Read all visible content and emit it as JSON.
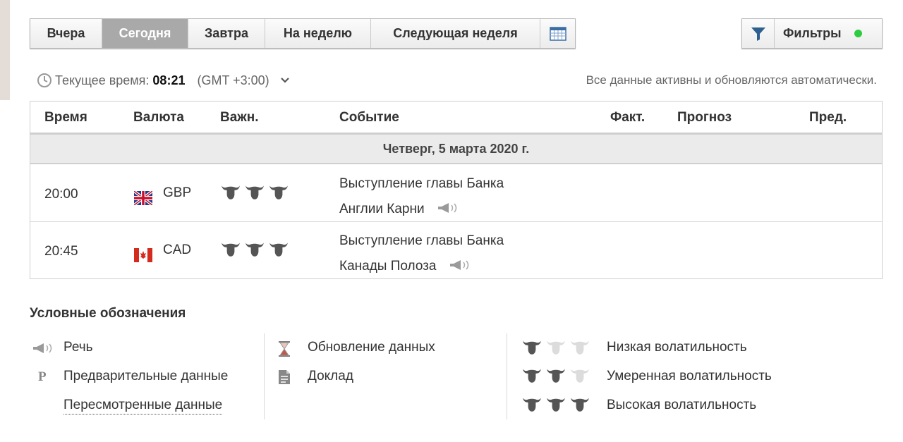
{
  "tabs": [
    {
      "label": "Вчера",
      "active": false
    },
    {
      "label": "Сегодня",
      "active": true
    },
    {
      "label": "Завтра",
      "active": false
    },
    {
      "label": "На неделю",
      "active": false
    },
    {
      "label": "Следующая неделя",
      "active": false
    }
  ],
  "calendar_icon": "calendar-icon",
  "filters": {
    "label": "Фильтры",
    "icon": "filter-icon",
    "status_color": "#2ecc40"
  },
  "time": {
    "label": "Текущее время:",
    "value": "08:21",
    "timezone": "(GMT +3:00)",
    "icon": "clock-icon"
  },
  "auto_update_text": "Все данные активны и обновляются автоматически.",
  "table": {
    "headers": {
      "time": "Время",
      "currency": "Валюта",
      "importance": "Важн.",
      "event": "Событие",
      "actual": "Факт.",
      "forecast": "Прогноз",
      "previous": "Пред."
    },
    "day_label": "Четверг, 5 марта 2020 г.",
    "rows": [
      {
        "time": "20:00",
        "currency": "GBP",
        "flag": "gb-flag-icon",
        "importance": 3,
        "event_line1": "Выступление главы Банка",
        "event_line2": "Англии Карни",
        "event_icon": "speech-icon",
        "actual": "",
        "forecast": "",
        "previous": ""
      },
      {
        "time": "20:45",
        "currency": "CAD",
        "flag": "ca-flag-icon",
        "importance": 3,
        "event_line1": "Выступление главы Банка",
        "event_line2": "Канады Полоза",
        "event_icon": "speech-icon",
        "actual": "",
        "forecast": "",
        "previous": ""
      }
    ]
  },
  "legend": {
    "title": "Условные обозначения",
    "speech": "Речь",
    "preliminary": "Предварительные данные",
    "revised": "Пересмотренные данные",
    "data_update": "Обновление данных",
    "report": "Доклад",
    "low": "Низкая волатильность",
    "moderate": "Умеренная волатильность",
    "high": "Высокая волатильность",
    "preliminary_mark": "P"
  },
  "colors": {
    "bull_active": "#555555",
    "bull_inactive": "#dcdcdc",
    "tab_active_bg": "#a9a9a9"
  }
}
